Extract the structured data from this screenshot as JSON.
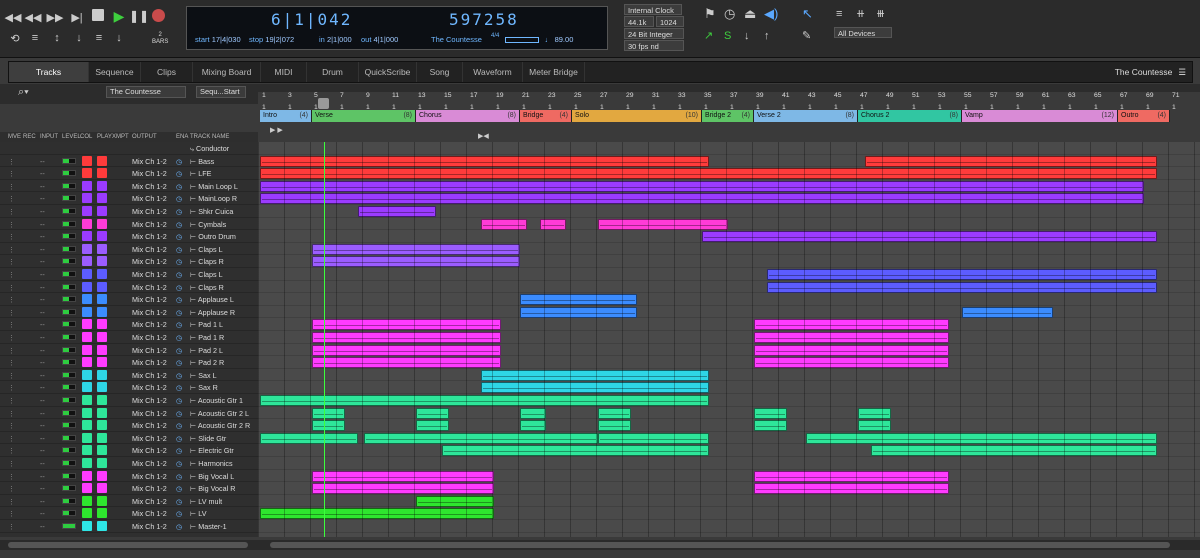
{
  "transport": {
    "bars_label": "BARS",
    "bars_value": "2",
    "counter_main": "6|1|042",
    "counter_sub": "597258",
    "start_label": "start",
    "start_value": "17|4|030",
    "stop_label": "stop",
    "stop_value": "19|2|072",
    "in_label": "in",
    "in_value": "2|1|000",
    "out_label": "out",
    "out_value": "4|1|000",
    "sequence_name": "The Countesse",
    "meter": "4/4",
    "tempo": "89.00"
  },
  "clock": {
    "source": "Internal Clock",
    "rate": "44.1k",
    "buffer": "1024",
    "bit_depth": "24 Bit Integer",
    "fps": "30 fps nd",
    "devices": "All Devices"
  },
  "tabs": [
    "Tracks",
    "Sequence",
    "Clips",
    "Mixing Board",
    "MIDI",
    "Drum",
    "QuickScribe",
    "Song",
    "Waveform",
    "Meter Bridge"
  ],
  "active_tab": "Tracks",
  "project_name": "The Countesse",
  "subbar": {
    "sequence_select": "The Countesse",
    "start_select": "Sequ...Start"
  },
  "column_headers": [
    "MVE",
    "REC",
    "INPUT",
    "LEVEL",
    "COL",
    "PLAY",
    "XMPT",
    "OUTPUT",
    "ENA",
    "TRACK NAME"
  ],
  "ruler_bars": [
    "1",
    "3",
    "5",
    "7",
    "9",
    "11",
    "13",
    "15",
    "17",
    "19",
    "21",
    "23",
    "25",
    "27",
    "29",
    "31",
    "33",
    "35",
    "37",
    "39",
    "41",
    "43",
    "45",
    "47",
    "49",
    "51",
    "53",
    "55",
    "57",
    "59",
    "61",
    "63",
    "65",
    "67",
    "69",
    "71"
  ],
  "ruler_subs": [
    "1",
    "1",
    "1",
    "1",
    "1",
    "1",
    "1",
    "1",
    "1",
    "1",
    "1",
    "1",
    "1",
    "1",
    "1",
    "1",
    "1",
    "1",
    "1",
    "1",
    "1",
    "1",
    "1",
    "1",
    "1",
    "1",
    "1",
    "1",
    "1",
    "1",
    "1",
    "1",
    "1",
    "1",
    "1",
    "1"
  ],
  "markers": [
    {
      "label": "Intro",
      "count": "(4)",
      "color": "#7eb8e6"
    },
    {
      "label": "Verse",
      "count": "(8)",
      "color": "#5ec466"
    },
    {
      "label": "Chorus",
      "count": "(8)",
      "color": "#d98bd6"
    },
    {
      "label": "Bridge",
      "count": "(4)",
      "color": "#ef6a62"
    },
    {
      "label": "Solo",
      "count": "(10)",
      "color": "#e2a840"
    },
    {
      "label": "Bridge 2",
      "count": "(4)",
      "color": "#5ec466"
    },
    {
      "label": "Verse 2",
      "count": "(8)",
      "color": "#7eb8e6"
    },
    {
      "label": "Chorus 2",
      "count": "(8)",
      "color": "#31c6a2"
    },
    {
      "label": "Vamp",
      "count": "(12)",
      "color": "#d98bd6"
    },
    {
      "label": "Outro",
      "count": "(4)",
      "color": "#ef6a62"
    }
  ],
  "conductor_label": "Conductor",
  "tracks": [
    {
      "name": "Bass",
      "output": "Mix Ch 1-2",
      "color": "#ff3b3b"
    },
    {
      "name": "LFE",
      "output": "Mix Ch 1-2",
      "color": "#ff3b3b"
    },
    {
      "name": "Main Loop L",
      "output": "Mix Ch 1-2",
      "color": "#9b3bff"
    },
    {
      "name": "MainLoop R",
      "output": "Mix Ch 1-2",
      "color": "#9b3bff"
    },
    {
      "name": "Shkr Cuica",
      "output": "Mix Ch 1-2",
      "color": "#9b3bff"
    },
    {
      "name": "Cymbals",
      "output": "Mix Ch 1-2",
      "color": "#ff3bd7"
    },
    {
      "name": "Outro Drum",
      "output": "Mix Ch 1-2",
      "color": "#9b3bff"
    },
    {
      "name": "Claps L",
      "output": "Mix Ch 1-2",
      "color": "#9b5cff"
    },
    {
      "name": "Claps R",
      "output": "Mix Ch 1-2",
      "color": "#9b5cff"
    },
    {
      "name": "Claps  L",
      "output": "Mix Ch 1-2",
      "color": "#5c5cff"
    },
    {
      "name": "Claps  R",
      "output": "Mix Ch 1-2",
      "color": "#5c5cff"
    },
    {
      "name": "Applause L",
      "output": "Mix Ch 1-2",
      "color": "#3b8cff"
    },
    {
      "name": "Applause R",
      "output": "Mix Ch 1-2",
      "color": "#3b8cff"
    },
    {
      "name": "Pad 1 L",
      "output": "Mix Ch 1-2",
      "color": "#ff3bff"
    },
    {
      "name": "Pad 1 R",
      "output": "Mix Ch 1-2",
      "color": "#ff3bff"
    },
    {
      "name": "Pad 2 L",
      "output": "Mix Ch 1-2",
      "color": "#ff3bff"
    },
    {
      "name": "Pad 2 R",
      "output": "Mix Ch 1-2",
      "color": "#ff3bff"
    },
    {
      "name": "Sax L",
      "output": "Mix Ch 1-2",
      "color": "#2ed6e6"
    },
    {
      "name": "Sax R",
      "output": "Mix Ch 1-2",
      "color": "#2ed6e6"
    },
    {
      "name": "Acoustic Gtr 1",
      "output": "Mix Ch 1-2",
      "color": "#2ee69a"
    },
    {
      "name": "Acoustic Gtr 2 L",
      "output": "Mix Ch 1-2",
      "color": "#2ee69a"
    },
    {
      "name": "Acoustic Gtr 2 R",
      "output": "Mix Ch 1-2",
      "color": "#2ee69a"
    },
    {
      "name": "Slide Gtr",
      "output": "Mix Ch 1-2",
      "color": "#2ee69a"
    },
    {
      "name": "Electric Gtr",
      "output": "Mix Ch 1-2",
      "color": "#2ee69a"
    },
    {
      "name": "Harmonics",
      "output": "Mix Ch 1-2",
      "color": "#2ee69a"
    },
    {
      "name": "Big Vocal L",
      "output": "Mix Ch 1-2",
      "color": "#ff3bff"
    },
    {
      "name": "Big Vocal R",
      "output": "Mix Ch 1-2",
      "color": "#ff3bff"
    },
    {
      "name": "LV mult",
      "output": "Mix Ch 1-2",
      "color": "#2ee62e"
    },
    {
      "name": "LV",
      "output": "Mix Ch 1-2",
      "color": "#2ee62e"
    },
    {
      "name": "Master-1",
      "output": "Mix Ch 1-2",
      "color": "#2ee6e6"
    }
  ],
  "clips": [
    {
      "track": 0,
      "bars": [
        [
          1,
          35.5
        ],
        [
          47.5,
          70
        ]
      ]
    },
    {
      "track": 1,
      "bars": [
        [
          1,
          70
        ]
      ]
    },
    {
      "track": 2,
      "bars": [
        [
          1,
          69
        ]
      ]
    },
    {
      "track": 3,
      "bars": [
        [
          1,
          69
        ]
      ]
    },
    {
      "track": 4,
      "bars": [
        [
          8.5,
          14.5
        ]
      ]
    },
    {
      "track": 5,
      "bars": [
        [
          18,
          21.5
        ],
        [
          22.5,
          24.5
        ],
        [
          27,
          37
        ]
      ]
    },
    {
      "track": 6,
      "bars": [
        [
          35,
          70
        ]
      ]
    },
    {
      "track": 7,
      "bars": [
        [
          5,
          21
        ]
      ]
    },
    {
      "track": 8,
      "bars": [
        [
          5,
          21
        ]
      ]
    },
    {
      "track": 9,
      "bars": [
        [
          40,
          70
        ]
      ]
    },
    {
      "track": 10,
      "bars": [
        [
          40,
          70
        ]
      ]
    },
    {
      "track": 11,
      "bars": [
        [
          21,
          30
        ]
      ]
    },
    {
      "track": 12,
      "bars": [
        [
          21,
          30
        ],
        [
          55,
          62
        ]
      ]
    },
    {
      "track": 13,
      "bars": [
        [
          5,
          19.5
        ],
        [
          39,
          54
        ]
      ]
    },
    {
      "track": 14,
      "bars": [
        [
          5,
          19.5
        ],
        [
          39,
          54
        ]
      ]
    },
    {
      "track": 15,
      "bars": [
        [
          5,
          19.5
        ],
        [
          39,
          54
        ]
      ]
    },
    {
      "track": 16,
      "bars": [
        [
          5,
          19.5
        ],
        [
          39,
          54
        ]
      ]
    },
    {
      "track": 17,
      "bars": [
        [
          18,
          35.5
        ]
      ]
    },
    {
      "track": 18,
      "bars": [
        [
          18,
          35.5
        ]
      ]
    },
    {
      "track": 19,
      "bars": [
        [
          1,
          35.5
        ]
      ]
    },
    {
      "track": 20,
      "bars": [
        [
          5,
          7.5
        ],
        [
          13,
          15.5
        ],
        [
          21,
          23
        ],
        [
          27,
          29.5
        ],
        [
          39,
          41.5
        ],
        [
          47,
          49.5
        ]
      ]
    },
    {
      "track": 21,
      "bars": [
        [
          5,
          7.5
        ],
        [
          13,
          15.5
        ],
        [
          21,
          23
        ],
        [
          27,
          29.5
        ],
        [
          39,
          41.5
        ],
        [
          47,
          49.5
        ]
      ]
    },
    {
      "track": 22,
      "bars": [
        [
          1,
          8.5
        ],
        [
          9,
          27
        ],
        [
          27,
          35.5
        ],
        [
          43,
          70
        ]
      ]
    },
    {
      "track": 23,
      "bars": [
        [
          15,
          35.5
        ],
        [
          48,
          70
        ]
      ]
    },
    {
      "track": 25,
      "bars": [
        [
          5,
          19
        ],
        [
          39,
          54
        ]
      ]
    },
    {
      "track": 26,
      "bars": [
        [
          5,
          19
        ],
        [
          39,
          54
        ]
      ]
    },
    {
      "track": 27,
      "bars": [
        [
          13,
          19
        ]
      ]
    },
    {
      "track": 28,
      "bars": [
        [
          1,
          19
        ]
      ]
    }
  ]
}
